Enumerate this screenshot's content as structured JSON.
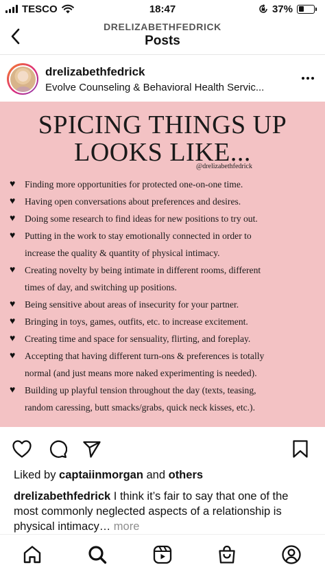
{
  "status_bar": {
    "carrier": "TESCO",
    "time": "18:47",
    "battery_percent": "37%",
    "battery_level": 0.37
  },
  "nav": {
    "subtitle": "DRELIZABETHFEDRICK",
    "title": "Posts"
  },
  "post": {
    "username": "drelizabethfedrick",
    "location": "Evolve Counseling & Behavioral Health Servic...",
    "image": {
      "title_line1": "SPICING THINGS UP",
      "title_line2": "LOOKS LIKE...",
      "handle": "@drelizabethfedrick",
      "tips": [
        {
          "lines": [
            "Finding more opportunities for protected one-on-one time."
          ]
        },
        {
          "lines": [
            "Having open conversations about preferences and desires."
          ]
        },
        {
          "lines": [
            "Doing some research to find ideas for new positions to try out."
          ]
        },
        {
          "lines": [
            "Putting in the work to stay emotionally connected in order to",
            "increase the quality & quantity of physical intimacy."
          ]
        },
        {
          "lines": [
            "Creating novelty by being intimate in different rooms, different",
            "times of day, and switching up positions."
          ]
        },
        {
          "lines": [
            "Being sensitive about areas of insecurity for your partner."
          ]
        },
        {
          "lines": [
            "Bringing in toys, games, outfits, etc. to increase excitement."
          ]
        },
        {
          "lines": [
            "Creating time and space for sensuality, flirting, and foreplay."
          ]
        },
        {
          "lines": [
            "Accepting that having different turn-ons & preferences is totally",
            "normal (and just means more naked experimenting is needed)."
          ]
        },
        {
          "lines": [
            "Building up playful tension throughout the day (texts, teasing,",
            "random caressing, butt smacks/grabs, quick neck kisses, etc.)."
          ]
        }
      ]
    },
    "likes": {
      "prefix": "Liked by ",
      "user": "captaiinmorgan",
      "middle": " and ",
      "others": "others"
    },
    "caption": {
      "user": "drelizabethfedrick",
      "text": " I think it’s fair to say that one of the most commonly neglected aspects of a relationship is physical intimacy…",
      "more": " more"
    }
  },
  "colors": {
    "post_background": "#f3c2c4",
    "text": "#111111",
    "muted": "#8e8e8e"
  },
  "icons": {
    "back": "chevron-left-icon",
    "more": "more-horizontal-icon",
    "like": "heart-icon",
    "comment": "comment-icon",
    "share": "send-icon",
    "save": "bookmark-icon",
    "tabs": [
      "home-icon",
      "search-icon",
      "reels-icon",
      "shop-icon",
      "profile-icon"
    ]
  }
}
